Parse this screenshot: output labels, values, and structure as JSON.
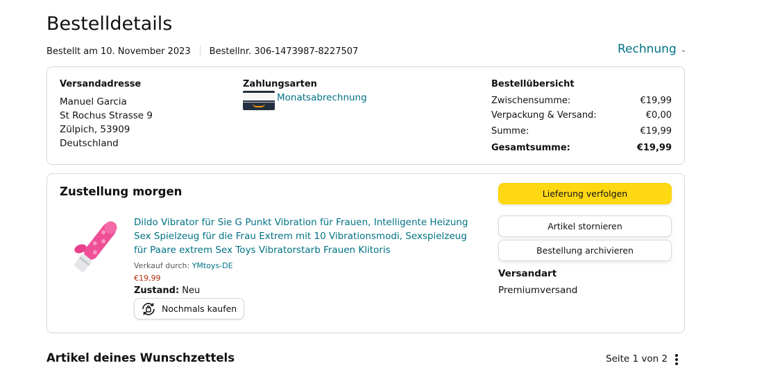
{
  "header": {
    "title": "Bestelldetails",
    "ordered_on": "Bestellt am 10. November 2023",
    "order_number": "Bestellnr. 306-1473987-8227507",
    "invoice_label": "Rechnung"
  },
  "summary_card": {
    "shipping_address": {
      "heading": "Versandadresse",
      "name": "Manuel Garcia",
      "street": "St Rochus Strasse 9",
      "city": "Zülpich, 53909",
      "country": "Deutschland"
    },
    "payment": {
      "heading": "Zahlungsarten",
      "method": "Monatsabrechnung"
    },
    "order_summary": {
      "heading": "Bestellübersicht",
      "rows": [
        {
          "label": "Zwischensumme:",
          "value": "€19,99"
        },
        {
          "label": "Verpackung & Versand:",
          "value": "€0,00"
        },
        {
          "label": "Summe:",
          "value": "€19,99"
        },
        {
          "label": "Gesamtsumme:",
          "value": "€19,99"
        }
      ]
    }
  },
  "delivery_card": {
    "status": "Zustellung morgen",
    "product": {
      "title": "Dildo Vibrator für Sie G Punkt Vibration für Frauen, Intelligente Heizung Sex Spielzeug für die Frau Extrem mit 10 Vibrationsmodi, Sexspielzeug für Paare extrem Sex Toys Vibratorstarb Frauen Klitoris",
      "seller_label": "Verkauf durch: ",
      "seller_name": "YMtoys-DE",
      "price": "€19,99",
      "condition_label": "Zustand:",
      "condition_value": " Neu",
      "buy_again_label": "Nochmals kaufen"
    },
    "actions": {
      "track": "Lieferung verfolgen",
      "cancel": "Artikel stornieren",
      "archive": "Bestellung archivieren"
    },
    "shipping_method": {
      "heading": "Versandart",
      "value": "Premiumversand"
    }
  },
  "wishlist": {
    "title": "Artikel deines Wunschzettels",
    "pager": "Seite 1 von 2"
  },
  "colors": {
    "link": "#007185",
    "primary_button": "#ffd814",
    "price": "#b12704",
    "product_pink": "#e8408a"
  }
}
